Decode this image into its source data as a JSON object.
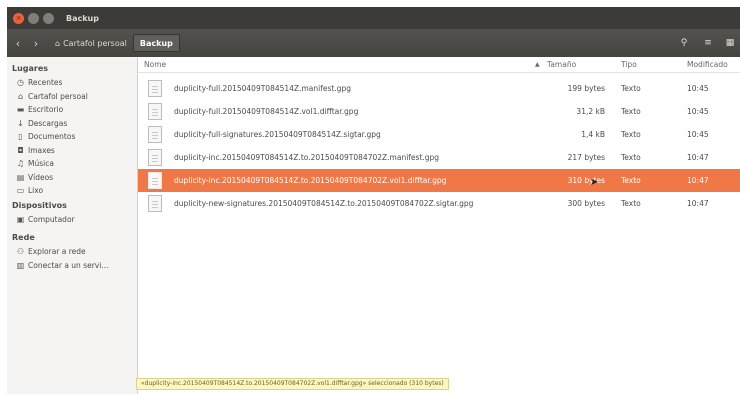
{
  "window": {
    "title": "Backup"
  },
  "toolbar": {
    "back": "‹",
    "forward": "›",
    "breadcrumb": [
      {
        "label": "Cartafol persoal"
      },
      {
        "label": "Backup"
      }
    ],
    "search_icon": "search-icon",
    "menu_icon": "list-menu-icon"
  },
  "sidebar": {
    "sections": [
      {
        "heading": "Lugares",
        "items": [
          {
            "label": "Recentes",
            "icon": "clock-icon"
          },
          {
            "label": "Cartafol persoal",
            "icon": "home-icon"
          },
          {
            "label": "Escritorio",
            "icon": "desktop-icon"
          },
          {
            "label": "Descargas",
            "icon": "download-icon"
          },
          {
            "label": "Documentos",
            "icon": "document-icon"
          },
          {
            "label": "Imaxes",
            "icon": "camera-icon"
          },
          {
            "label": "Música",
            "icon": "music-icon"
          },
          {
            "label": "Vídeos",
            "icon": "film-icon"
          },
          {
            "label": "Lixo",
            "icon": "trash-icon"
          }
        ]
      },
      {
        "heading": "Dispositivos",
        "items": [
          {
            "label": "Computador",
            "icon": "computer-icon"
          }
        ]
      },
      {
        "heading": "Rede",
        "items": [
          {
            "label": "Explorar a rede",
            "icon": "network-icon"
          },
          {
            "label": "Conectar a un servi...",
            "icon": "server-icon"
          }
        ]
      }
    ]
  },
  "columns": {
    "name": "Nome",
    "size": "Tamaño",
    "type": "Tipo",
    "modified": "Modificado",
    "sort_indicator": "▲"
  },
  "files": [
    {
      "name": "duplicity-full.20150409T084514Z.manifest.gpg",
      "size": "199 bytes",
      "type": "Texto",
      "modified": "10:45",
      "selected": false
    },
    {
      "name": "duplicity-full.20150409T084514Z.vol1.difftar.gpg",
      "size": "31,2 kB",
      "type": "Texto",
      "modified": "10:45",
      "selected": false
    },
    {
      "name": "duplicity-full-signatures.20150409T084514Z.sigtar.gpg",
      "size": "1,4 kB",
      "type": "Texto",
      "modified": "10:45",
      "selected": false
    },
    {
      "name": "duplicity-inc.20150409T084514Z.to.20150409T084702Z.manifest.gpg",
      "size": "217 bytes",
      "type": "Texto",
      "modified": "10:47",
      "selected": false
    },
    {
      "name": "duplicity-inc.20150409T084514Z.to.20150409T084702Z.vol1.difftar.gpg",
      "size": "310 bytes",
      "type": "Texto",
      "modified": "10:47",
      "selected": true
    },
    {
      "name": "duplicity-new-signatures.20150409T084514Z.to.20150409T084702Z.sigtar.gpg",
      "size": "300 bytes",
      "type": "Texto",
      "modified": "10:47",
      "selected": false
    }
  ],
  "status": "«duplicity-inc.20150409T084514Z.to.20150409T084702Z.vol1.difftar.gpg» seleccionado (310 bytes)",
  "colors": {
    "selection": "#f07746",
    "titlebar": "#3c3b37",
    "close_button": "#e9623c"
  }
}
